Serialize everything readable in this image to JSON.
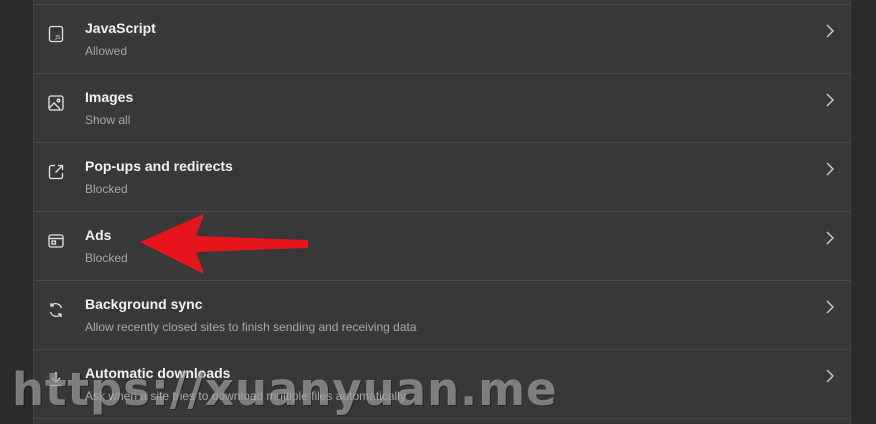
{
  "settings": {
    "items": [
      {
        "title": "JavaScript",
        "subtitle": "Allowed",
        "icon": "javascript-icon"
      },
      {
        "title": "Images",
        "subtitle": "Show all",
        "icon": "image-icon"
      },
      {
        "title": "Pop-ups and redirects",
        "subtitle": "Blocked",
        "icon": "popup-icon"
      },
      {
        "title": "Ads",
        "subtitle": "Blocked",
        "icon": "ads-icon"
      },
      {
        "title": "Background sync",
        "subtitle": "Allow recently closed sites to finish sending and receiving data",
        "icon": "sync-icon"
      },
      {
        "title": "Automatic downloads",
        "subtitle": "Ask when a site tries to download multiple files automatically",
        "icon": "download-icon"
      }
    ]
  },
  "annotation": {
    "arrow_color": "#e8141c",
    "watermark_text": "https://xuanyuan.me"
  },
  "colors": {
    "background": "#2b2b2b",
    "panel": "#383838",
    "title_text": "#f2f2f2",
    "subtitle_text": "#a8a8a8"
  }
}
